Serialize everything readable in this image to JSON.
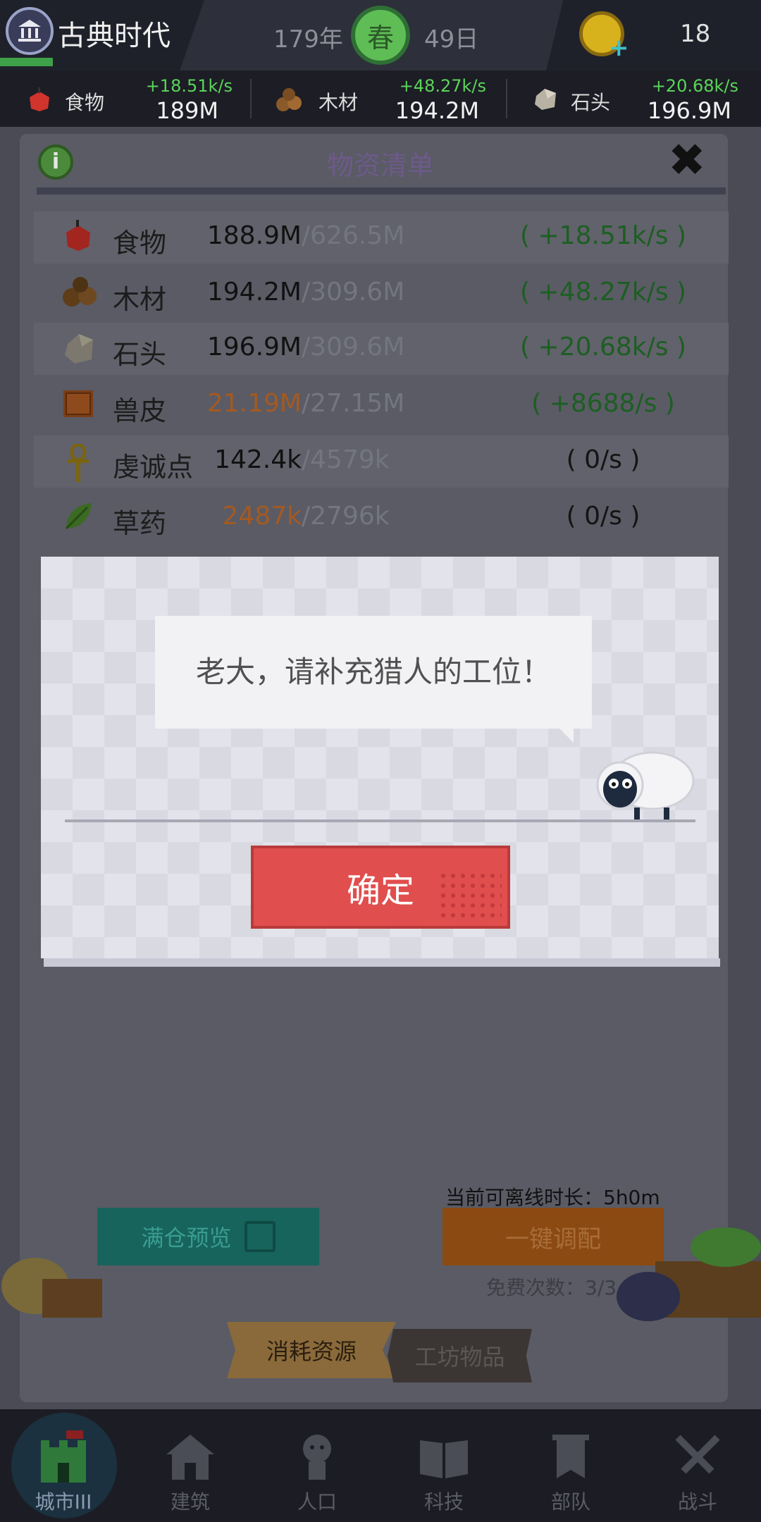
{
  "header": {
    "era_title": "古典时代",
    "year": "179年",
    "season": "春",
    "day": "49日",
    "coins": "18",
    "era_icon": "museum-icon",
    "coin_icon": "coin-plus-icon"
  },
  "resource_bar": [
    {
      "name": "食物",
      "rate": "+18.51k/s",
      "amount": "189M",
      "icon": "apple-icon"
    },
    {
      "name": "木材",
      "rate": "+48.27k/s",
      "amount": "194.2M",
      "icon": "wood-icon"
    },
    {
      "name": "石头",
      "rate": "+20.68k/s",
      "amount": "196.9M",
      "icon": "stone-icon"
    }
  ],
  "panel": {
    "title": "物资清单",
    "rows": [
      {
        "name": "食物",
        "current": "188.9M",
        "capacity": "/626.5M",
        "rate": "( +18.51k/s )",
        "icon": "apple-icon"
      },
      {
        "name": "木材",
        "current": "194.2M",
        "capacity": "/309.6M",
        "rate": "( +48.27k/s )",
        "icon": "wood-icon"
      },
      {
        "name": "石头",
        "current": "196.9M",
        "capacity": "/309.6M",
        "rate": "( +20.68k/s )",
        "icon": "stone-icon"
      },
      {
        "name": "兽皮",
        "current": "21.19M",
        "capacity": "/27.15M",
        "rate": "( +8688/s )",
        "icon": "hide-icon"
      },
      {
        "name": "虔诚点",
        "current": "142.4k",
        "capacity": "/4579k",
        "rate": "( 0/s )",
        "icon": "ankh-icon"
      },
      {
        "name": "草药",
        "current": "2487k",
        "capacity": "/2796k",
        "rate": "( 0/s )",
        "icon": "herb-icon"
      }
    ],
    "full_preview_label": "满仓预览",
    "offline_label": "当前可离线时长：5h0m",
    "assign_label": "一键调配",
    "free_label": "免费次数：3/3",
    "tab_consume": "消耗资源",
    "tab_workshop": "工坊物品"
  },
  "dialog": {
    "message": "老大，请补充猎人的工位！",
    "ok_label": "确定"
  },
  "nav": [
    {
      "label": "城市III",
      "icon": "castle-icon"
    },
    {
      "label": "建筑",
      "icon": "house-icon"
    },
    {
      "label": "人口",
      "icon": "person-icon"
    },
    {
      "label": "科技",
      "icon": "book-icon"
    },
    {
      "label": "部队",
      "icon": "banner-icon"
    },
    {
      "label": "战斗",
      "icon": "swords-icon"
    }
  ],
  "colors": {
    "accent_green": "#5bd45a",
    "confirm_red": "#e14e4e",
    "assign_orange": "#d2741c",
    "preview_teal": "#1a9e8f"
  }
}
